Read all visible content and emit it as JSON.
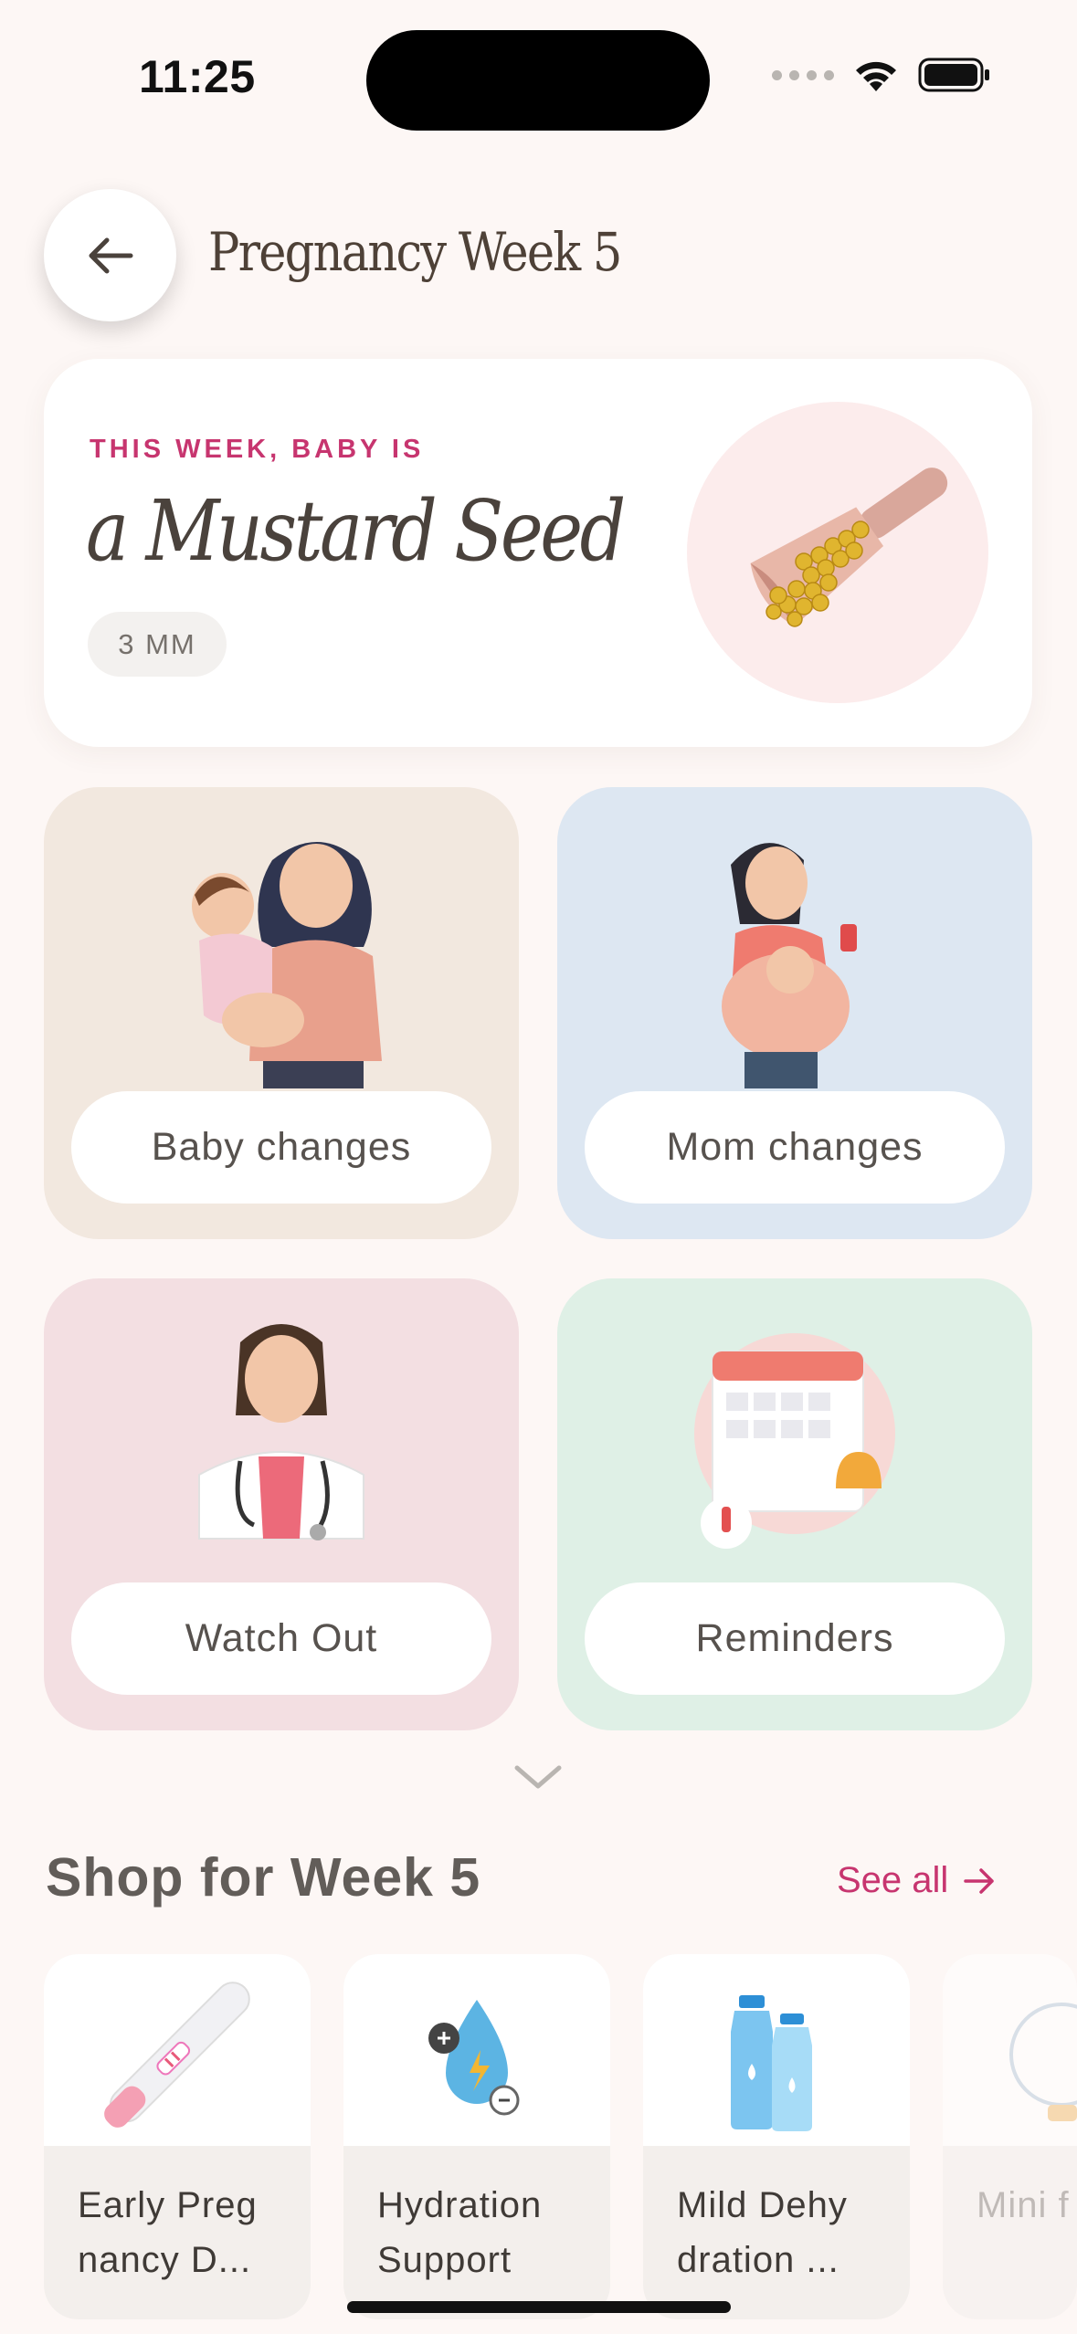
{
  "status": {
    "time": "11:25"
  },
  "header": {
    "title": "Pregnancy Week 5"
  },
  "hero": {
    "eyebrow": "THIS WEEK, BABY IS",
    "title": "a Mustard Seed",
    "size": "3 MM"
  },
  "tiles": [
    {
      "label": "Baby changes"
    },
    {
      "label": "Mom changes"
    },
    {
      "label": "Watch Out"
    },
    {
      "label": "Reminders"
    }
  ],
  "shop": {
    "title": "Shop for Week 5",
    "see_all": "See all",
    "products": [
      {
        "name": "Early Preg nancy D..."
      },
      {
        "name": "Hydration Support"
      },
      {
        "name": "Mild Dehy dration ..."
      },
      {
        "name": "Mini f"
      }
    ]
  },
  "colors": {
    "accent": "#c7356f",
    "background": "#fdf7f5"
  },
  "icons": [
    "back-arrow-icon",
    "chevron-down-icon",
    "arrow-right-icon",
    "wifi-icon",
    "battery-icon"
  ]
}
